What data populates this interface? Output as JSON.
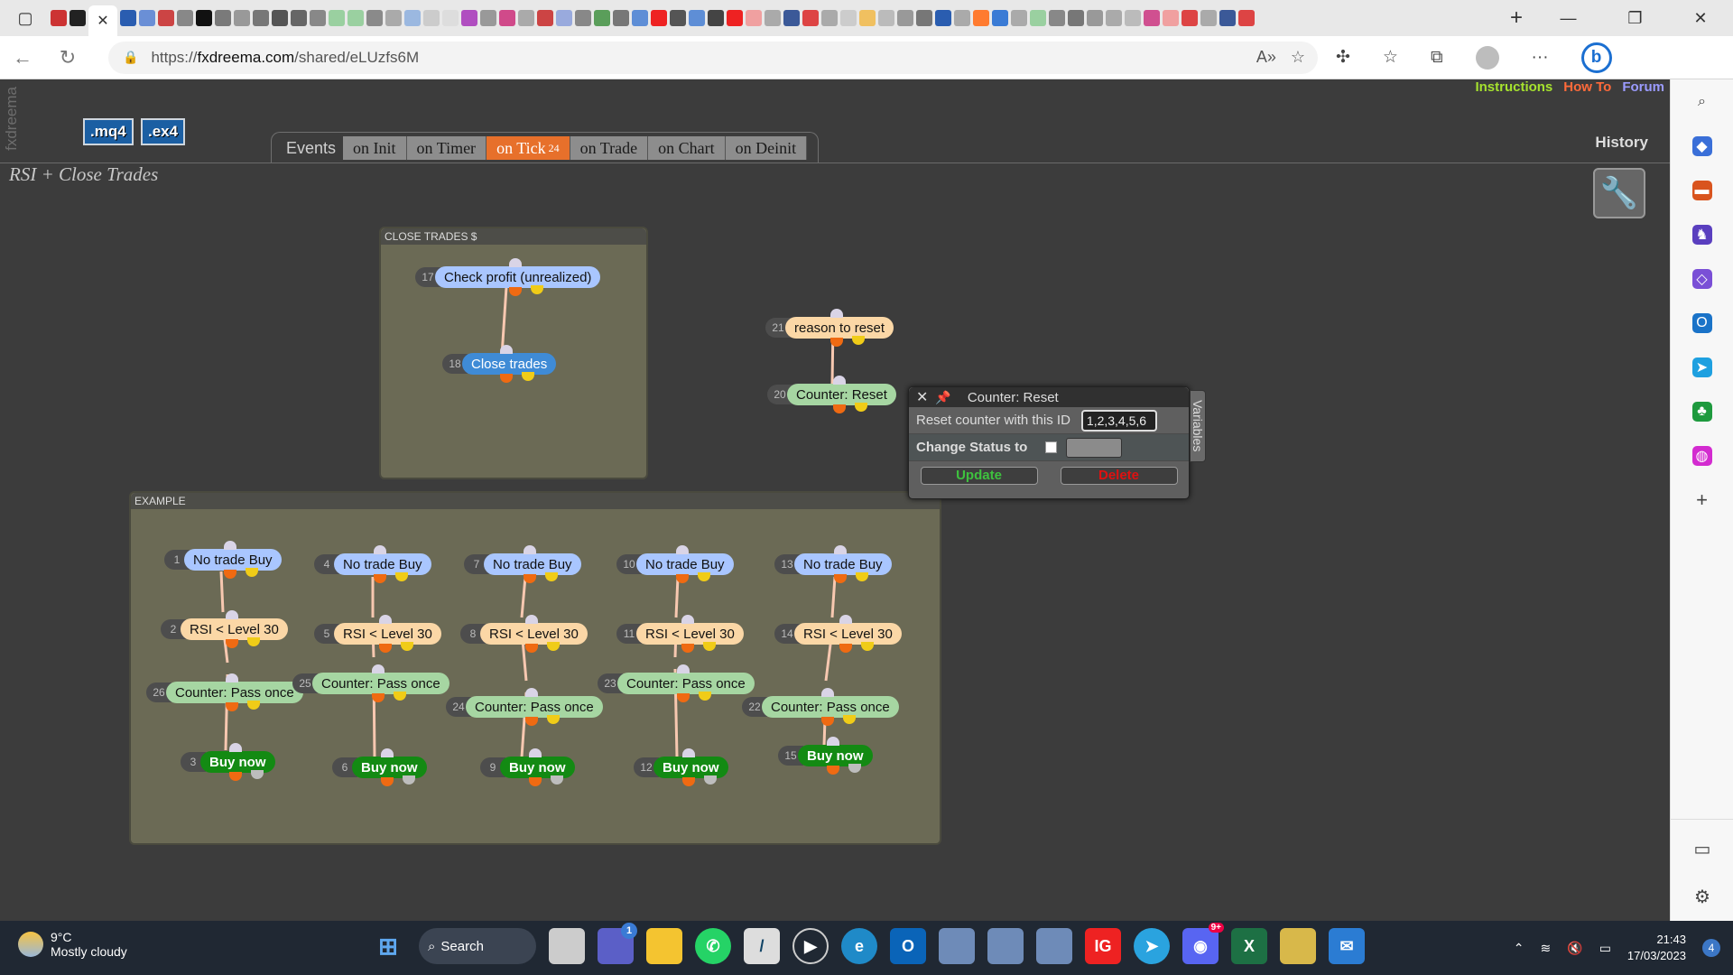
{
  "browser": {
    "url_prefix": "https://",
    "url_domain": "fxdreema.com",
    "url_path": "/shared/eLUzfs6M"
  },
  "page": {
    "side_label": "fxdreema",
    "project_title": "RSI + Close Trades",
    "mq4_label": ".mq4",
    "ex4_label": ".ex4",
    "links": {
      "instructions": "Instructions",
      "howto": "How To",
      "forum": "Forum"
    },
    "history_label": "History",
    "events_label": "Events",
    "event_tabs": [
      {
        "label": "on Init"
      },
      {
        "label": "on Timer"
      },
      {
        "label": "on Tick",
        "count": "24"
      },
      {
        "label": "on Trade"
      },
      {
        "label": "on Chart"
      },
      {
        "label": "on Deinit"
      }
    ],
    "colors": {
      "instructions": "#a6e22e",
      "howto": "#ff6a3a",
      "forum": "#9b9bff",
      "active_tab": "#e7702b"
    }
  },
  "groups": {
    "close_trades": {
      "title": "CLOSE TRADES $"
    },
    "example": {
      "title": "EXAMPLE"
    }
  },
  "nodes": [
    {
      "id": "17",
      "label": "Check profit (unrealized)"
    },
    {
      "id": "18",
      "label": "Close trades"
    },
    {
      "id": "21",
      "label": "reason to reset"
    },
    {
      "id": "20",
      "label": "Counter: Reset"
    },
    {
      "id": "1",
      "label": "No trade Buy"
    },
    {
      "id": "2",
      "label": "RSI < Level 30"
    },
    {
      "id": "26",
      "label": "Counter: Pass once"
    },
    {
      "id": "3",
      "label": "Buy now"
    },
    {
      "id": "4",
      "label": "No trade Buy"
    },
    {
      "id": "5",
      "label": "RSI < Level 30"
    },
    {
      "id": "25",
      "label": "Counter: Pass once"
    },
    {
      "id": "6",
      "label": "Buy now"
    },
    {
      "id": "7",
      "label": "No trade Buy"
    },
    {
      "id": "8",
      "label": "RSI < Level 30"
    },
    {
      "id": "24",
      "label": "Counter: Pass once"
    },
    {
      "id": "9",
      "label": "Buy now"
    },
    {
      "id": "10",
      "label": "No trade Buy"
    },
    {
      "id": "11",
      "label": "RSI < Level 30"
    },
    {
      "id": "23",
      "label": "Counter: Pass once"
    },
    {
      "id": "12",
      "label": "Buy now"
    },
    {
      "id": "13",
      "label": "No trade Buy"
    },
    {
      "id": "14",
      "label": "RSI < Level 30"
    },
    {
      "id": "22",
      "label": "Counter: Pass once"
    },
    {
      "id": "15",
      "label": "Buy now"
    }
  ],
  "popup": {
    "title": "Counter: Reset",
    "reset_label": "Reset counter with this ID",
    "reset_value": "1,2,3,4,5,6",
    "status_label": "Change Status to",
    "update_label": "Update",
    "delete_label": "Delete",
    "side_tab": "Variables"
  },
  "taskbar": {
    "temp": "9°C",
    "condition": "Mostly cloudy",
    "search_label": "Search",
    "time": "21:43",
    "date": "17/03/2023",
    "notifications": "4",
    "teams_badge": "1",
    "discord_badge": "9+"
  }
}
